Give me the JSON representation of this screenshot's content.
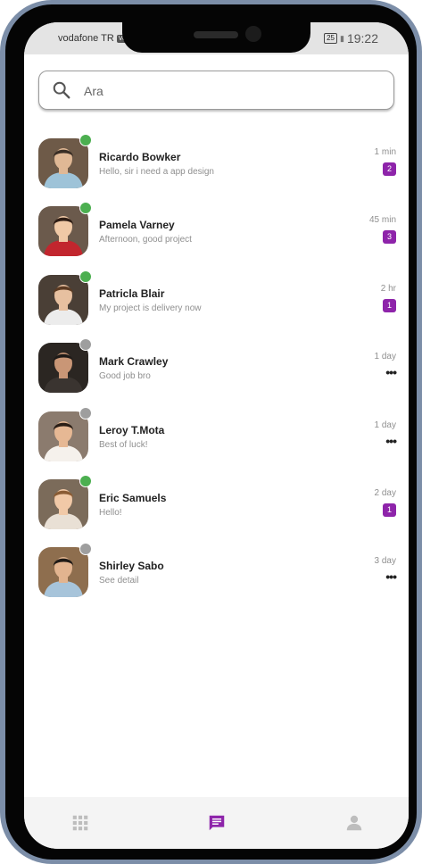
{
  "status_bar": {
    "carrier": "vodafone TR",
    "network_badge": "VoLTE",
    "battery": "25",
    "time": "19:22"
  },
  "search": {
    "placeholder": "Ara",
    "value": ""
  },
  "colors": {
    "accent": "#8e24aa",
    "online": "#4caf50",
    "offline": "#9e9e9e",
    "frame": "#7c8ea8"
  },
  "conversations": [
    {
      "name": "Ricardo Bowker",
      "message": "Hello, sir i need a app design",
      "time": "1 min",
      "unread": "2",
      "status": "online"
    },
    {
      "name": "Pamela Varney",
      "message": "Afternoon, good project",
      "time": "45 min",
      "unread": "3",
      "status": "online"
    },
    {
      "name": "Patricla Blair",
      "message": "My project is delivery now",
      "time": "2 hr",
      "unread": "1",
      "status": "online"
    },
    {
      "name": "Mark Crawley",
      "message": "Good job bro",
      "time": "1 day",
      "unread": null,
      "status": "offline"
    },
    {
      "name": "Leroy T.Mota",
      "message": "Best of luck!",
      "time": "1 day",
      "unread": null,
      "status": "offline"
    },
    {
      "name": "Eric Samuels",
      "message": "Hello!",
      "time": "2 day",
      "unread": "1",
      "status": "online"
    },
    {
      "name": "Shirley Sabo",
      "message": "See detail",
      "time": "3 day",
      "unread": null,
      "status": "offline"
    }
  ],
  "bottom_nav": [
    {
      "icon": "grid-icon",
      "active": false
    },
    {
      "icon": "chat-icon",
      "active": true
    },
    {
      "icon": "profile-icon",
      "active": false
    }
  ]
}
